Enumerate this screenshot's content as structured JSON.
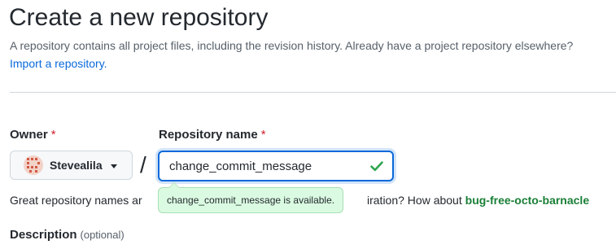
{
  "header": {
    "title": "Create a new repository",
    "description": "A repository contains all project files, including the revision history. Already have a project repository elsewhere?",
    "import_link": "Import a repository."
  },
  "form": {
    "owner": {
      "label": "Owner",
      "required_marker": "*",
      "selected_value": "Stevealila",
      "avatar_icon": "owner-avatar"
    },
    "separator": "/",
    "repository_name": {
      "label": "Repository name",
      "required_marker": "*",
      "value": "change_commit_message",
      "status_icon": "check-icon"
    },
    "availability_tooltip": "change_commit_message is available.",
    "hint": {
      "prefix": "Great repository names ar",
      "middle": "iration? How about",
      "suggestion": "bug-free-octo-barnacle"
    },
    "description": {
      "label": "Description",
      "optional_text": "(optional)"
    }
  },
  "colors": {
    "link": "#0969da",
    "success": "#1a7f37",
    "required": "#cf222e",
    "tooltip_bg": "#dafbe1",
    "focus_border": "#0969da"
  }
}
